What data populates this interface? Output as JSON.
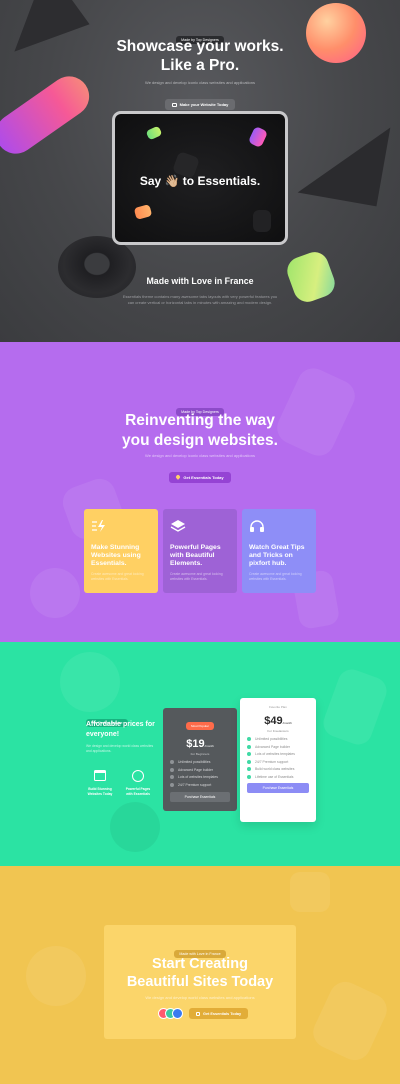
{
  "hero": {
    "badge": "Made by Top Designers",
    "title_line1": "Showcase your works.",
    "title_line2": "Like a Pro.",
    "subtitle": "We design and develop iconic class websites and applications",
    "button_label": "Make your Website Today",
    "screen_text": "Say 👋🏼 to Essentials.",
    "made_title": "Made with Love in France",
    "made_desc_line1": "Essentials theme contains many awesome tabs layouts with very powerful features you",
    "made_desc_line2": "can create vertical or horizontal tabs in minutes with amazing and modern design.",
    "colors": {
      "bg": "#46474a",
      "accent": "#ff6a8f"
    }
  },
  "reinvent": {
    "badge": "Made by Top Designers",
    "title_line1": "Reinventing the way",
    "title_line2": "you design websites.",
    "subtitle": "We design and develop iconic class websites and applications",
    "button_label": "Get Essentials Today",
    "cards": [
      {
        "icon": "lightning-icon",
        "title": "Make Stunning Websites using Essentials.",
        "desc": "Create awesome and great looking websites with Essentials.",
        "color": "#ffd063"
      },
      {
        "icon": "layers-icon",
        "title": "Powerful Pages with Beautiful Elements.",
        "desc": "Create awesome and great looking websites with Essentials.",
        "color": "#9e62d6"
      },
      {
        "icon": "headphones-icon",
        "title": "Watch Great Tips and Tricks on pixfort hub.",
        "desc": "Create awesome and great looking websites with Essentials.",
        "color": "#8e8ef7"
      }
    ]
  },
  "pricing": {
    "badge": "The Perfect Service",
    "title_line1": "Affordable prices for",
    "title_line2": "everyone!",
    "desc": "We design and develop world class websites and applications.",
    "features": [
      {
        "icon": "browser-icon",
        "label_line1": "Build Stunning",
        "label_line2": "Websites Today"
      },
      {
        "icon": "lock-icon",
        "label_line1": "Powerful Pages",
        "label_line2": "with Essentials"
      }
    ],
    "plan1": {
      "tag": "Most Popular",
      "price": "$19",
      "period": "/month",
      "name": "For Beginners",
      "items": [
        "Unlimited possibilities",
        "Advanced Page builder",
        "Lots of websites templates",
        "24/7 Premium support"
      ],
      "button": "Purchase Essentials"
    },
    "plan2": {
      "tag": "Favorite Plan",
      "price": "$49",
      "period": "/month",
      "name": "For Freelancers",
      "items": [
        "Unlimited possibilities",
        "Advanced Page builder",
        "Lots of websites templates",
        "24/7 Premium support",
        "Build world class websites",
        "Lifetime use of Essentials"
      ],
      "button": "Purchase Essentials"
    }
  },
  "cta": {
    "badge": "Made with Love in France",
    "title_line1": "Start Creating",
    "title_line2": "Beautiful Sites Today",
    "subtitle": "We design and develop world class websites and applications",
    "button_label": "Get Essentials Today"
  }
}
